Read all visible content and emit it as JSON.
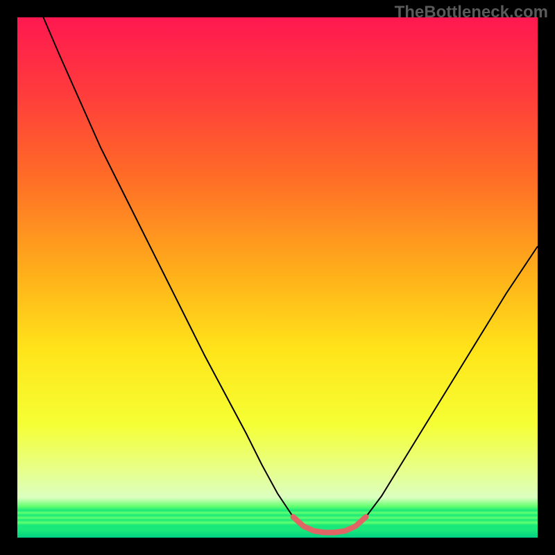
{
  "watermark": "TheBottleneck.com",
  "chart_data": {
    "type": "line",
    "title": "",
    "xlabel": "",
    "ylabel": "",
    "xlim": [
      0,
      100
    ],
    "ylim": [
      0,
      100
    ],
    "gradient_stops": [
      {
        "offset": 0,
        "color": "#ff1850"
      },
      {
        "offset": 14,
        "color": "#ff3a3d"
      },
      {
        "offset": 30,
        "color": "#ff6a27"
      },
      {
        "offset": 50,
        "color": "#ffb21a"
      },
      {
        "offset": 64,
        "color": "#ffe41a"
      },
      {
        "offset": 78,
        "color": "#f5ff33"
      },
      {
        "offset": 86,
        "color": "#e9ff80"
      },
      {
        "offset": 92.3,
        "color": "#dbffc0"
      },
      {
        "offset": 94,
        "color": "#62ff6f"
      },
      {
        "offset": 94.8,
        "color": "#19e87a"
      },
      {
        "offset": 95.2,
        "color": "#62ff6f"
      },
      {
        "offset": 95.7,
        "color": "#19e87a"
      },
      {
        "offset": 96.2,
        "color": "#62ff6f"
      },
      {
        "offset": 96.6,
        "color": "#19e87a"
      },
      {
        "offset": 97.1,
        "color": "#62ff6f"
      },
      {
        "offset": 97.6,
        "color": "#19e87a"
      },
      {
        "offset": 98.6,
        "color": "#19e87a"
      },
      {
        "offset": 100,
        "color": "#00d084"
      }
    ],
    "series": [
      {
        "name": "bottleneck-curve",
        "color": "#000000",
        "width": 2,
        "points": [
          {
            "x": 5.0,
            "y": 100.0
          },
          {
            "x": 8.0,
            "y": 93.0
          },
          {
            "x": 12.0,
            "y": 84.0
          },
          {
            "x": 16.0,
            "y": 75.0
          },
          {
            "x": 20.0,
            "y": 67.0
          },
          {
            "x": 24.0,
            "y": 59.0
          },
          {
            "x": 28.0,
            "y": 51.0
          },
          {
            "x": 32.0,
            "y": 43.0
          },
          {
            "x": 36.0,
            "y": 35.0
          },
          {
            "x": 40.0,
            "y": 27.5
          },
          {
            "x": 44.0,
            "y": 20.0
          },
          {
            "x": 47.0,
            "y": 14.0
          },
          {
            "x": 50.0,
            "y": 8.5
          },
          {
            "x": 53.0,
            "y": 4.0
          },
          {
            "x": 55.0,
            "y": 2.2
          },
          {
            "x": 57.0,
            "y": 1.3
          },
          {
            "x": 59.0,
            "y": 1.0
          },
          {
            "x": 61.0,
            "y": 1.0
          },
          {
            "x": 63.0,
            "y": 1.3
          },
          {
            "x": 65.0,
            "y": 2.2
          },
          {
            "x": 67.0,
            "y": 4.0
          },
          {
            "x": 70.0,
            "y": 8.0
          },
          {
            "x": 74.0,
            "y": 14.5
          },
          {
            "x": 78.0,
            "y": 21.0
          },
          {
            "x": 82.0,
            "y": 27.5
          },
          {
            "x": 86.0,
            "y": 34.0
          },
          {
            "x": 90.0,
            "y": 40.5
          },
          {
            "x": 94.0,
            "y": 47.0
          },
          {
            "x": 98.0,
            "y": 53.0
          },
          {
            "x": 100.0,
            "y": 56.0
          }
        ]
      },
      {
        "name": "optimal-zone",
        "color": "#e06666",
        "width": 8,
        "linecap": "round",
        "points": [
          {
            "x": 53.0,
            "y": 4.0
          },
          {
            "x": 55.0,
            "y": 2.2
          },
          {
            "x": 57.0,
            "y": 1.3
          },
          {
            "x": 59.0,
            "y": 1.0
          },
          {
            "x": 61.0,
            "y": 1.0
          },
          {
            "x": 63.0,
            "y": 1.3
          },
          {
            "x": 65.0,
            "y": 2.2
          },
          {
            "x": 67.0,
            "y": 4.0
          }
        ]
      }
    ]
  }
}
